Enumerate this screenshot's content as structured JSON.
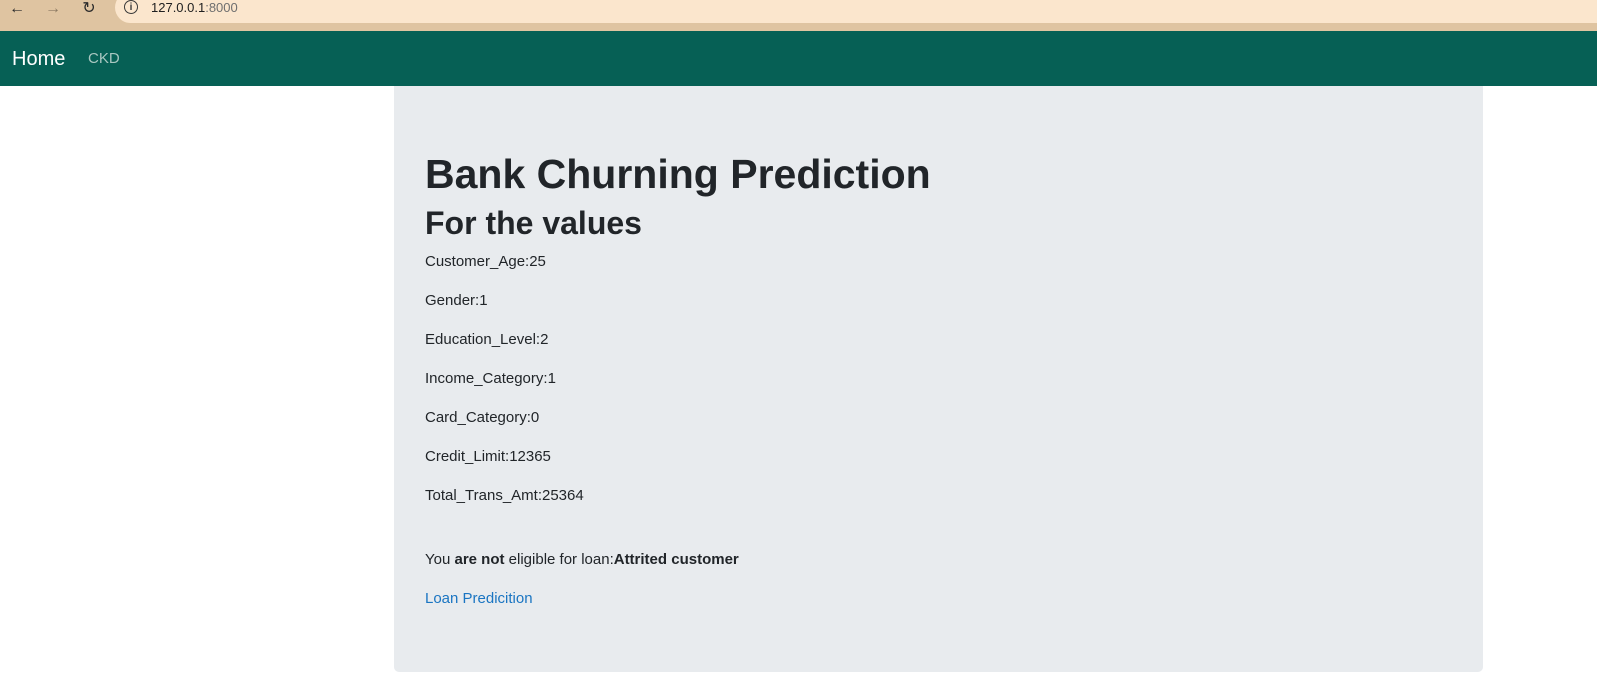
{
  "browser": {
    "back_glyph": "←",
    "forward_glyph": "→",
    "reload_glyph": "↻",
    "info_glyph": "i",
    "url_host": "127.0.0.1",
    "url_port": ":8000",
    "icons": [
      "arrow-left-icon",
      "arrow-right-icon",
      "reload-icon",
      "info-icon"
    ]
  },
  "navbar": {
    "brand": "Home",
    "links": [
      "CKD"
    ],
    "background": "#066055"
  },
  "card": {
    "title": "Bank Churning Prediction",
    "subtitle": "For the values",
    "values": [
      "Customer_Age:25",
      "Gender:1",
      "Education_Level:2",
      "Income_Category:1",
      "Card_Category:0",
      "Credit_Limit:12365",
      "Total_Trans_Amt:25364"
    ],
    "result": {
      "prefix": "You ",
      "emphasis": "are not",
      "middle": " eligible for loan:",
      "outcome": "Attrited customer"
    },
    "link": "Loan Predicition",
    "background": "#e8ebee",
    "link_color": "#1a75c2"
  }
}
